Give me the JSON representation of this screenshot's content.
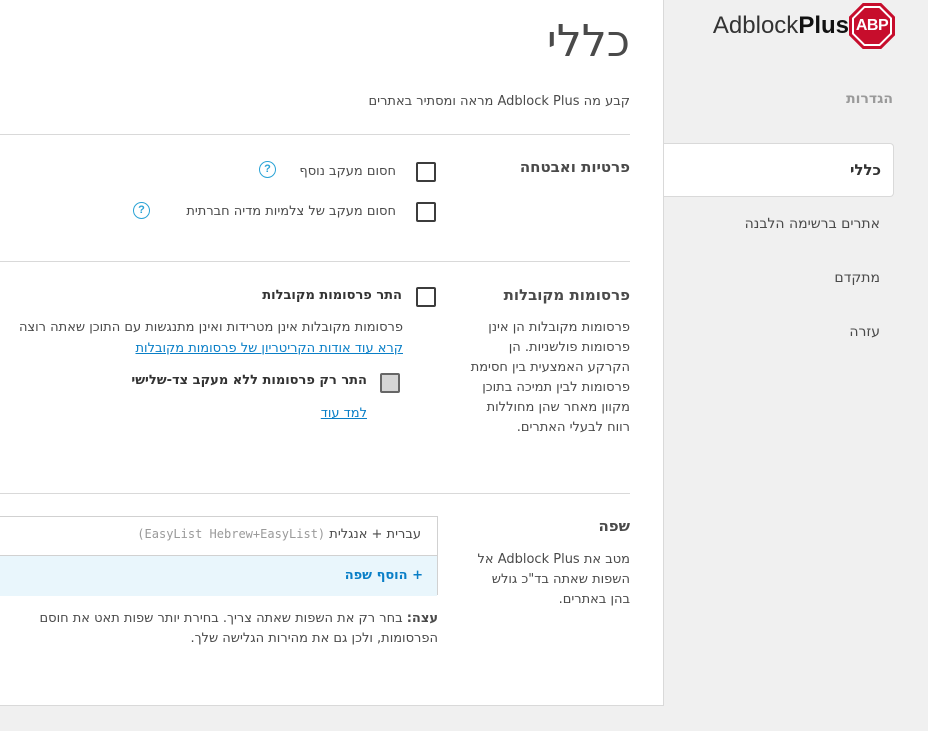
{
  "brand": {
    "logo_badge": "ABP",
    "name_regular": "Adblock",
    "name_bold": "Plus",
    "badge_color": "#c70d2c"
  },
  "sidebar": {
    "heading": "הגדרות",
    "items": [
      {
        "label": "כללי",
        "active": true
      },
      {
        "label": "אתרים ברשימה הלבנה",
        "active": false
      },
      {
        "label": "מתקדם",
        "active": false
      },
      {
        "label": "עזרה",
        "active": false
      }
    ]
  },
  "main": {
    "title": "כללי",
    "subtitle": "קבע מה Adblock Plus מראה ומסתיר באתרים",
    "privacy": {
      "title": "פרטיות ואבטחה",
      "options": [
        {
          "label": "חסום מעקב נוסף",
          "checked": false,
          "help_icon": "?"
        },
        {
          "label": "חסום מעקב של צלמיות מדיה חברתית",
          "checked": false,
          "help_icon": "?"
        }
      ]
    },
    "acceptable_ads": {
      "title": "פרסומות מקובלות",
      "description": "פרסומות מקובלות הן אינן פרסומות פולשניות. הן הקרקע האמצעית בין חסימת פרסומות לבין תמיכה בתוכן מקוון מאחר שהן מחוללות רווח לבעלי האתרים.",
      "allow_label": "התר פרסומות מקובלות",
      "allow_checked": false,
      "allow_desc": "פרסומות מקובלות אינן מטרידות ואינן מתנגשות עם התוכן שאתה רוצה",
      "criteria_link": "קרא עוד אודות הקריטריון של פרסומות מקובלות",
      "no_tracking_label": "התר רק פרסומות ללא מעקב צד-שלישי",
      "no_tracking_checked": false,
      "learn_more": "למד עוד"
    },
    "language": {
      "title": "שפה",
      "description": "מטב את Adblock Plus אל השפות שאתה בד\"כ גולש בהן באתרים.",
      "selected_name": "עברית + אנגלית",
      "selected_lists": "(EasyList Hebrew+EasyList)",
      "add_label": "+ הוסף שפה",
      "tip_bold": "עצה:",
      "tip_text": " בחר רק את השפות שאתה צריך. בחירת יותר שפות תאט את חוסם הפרסומות, ולכן גם את מהירות הגלישה שלך."
    }
  }
}
